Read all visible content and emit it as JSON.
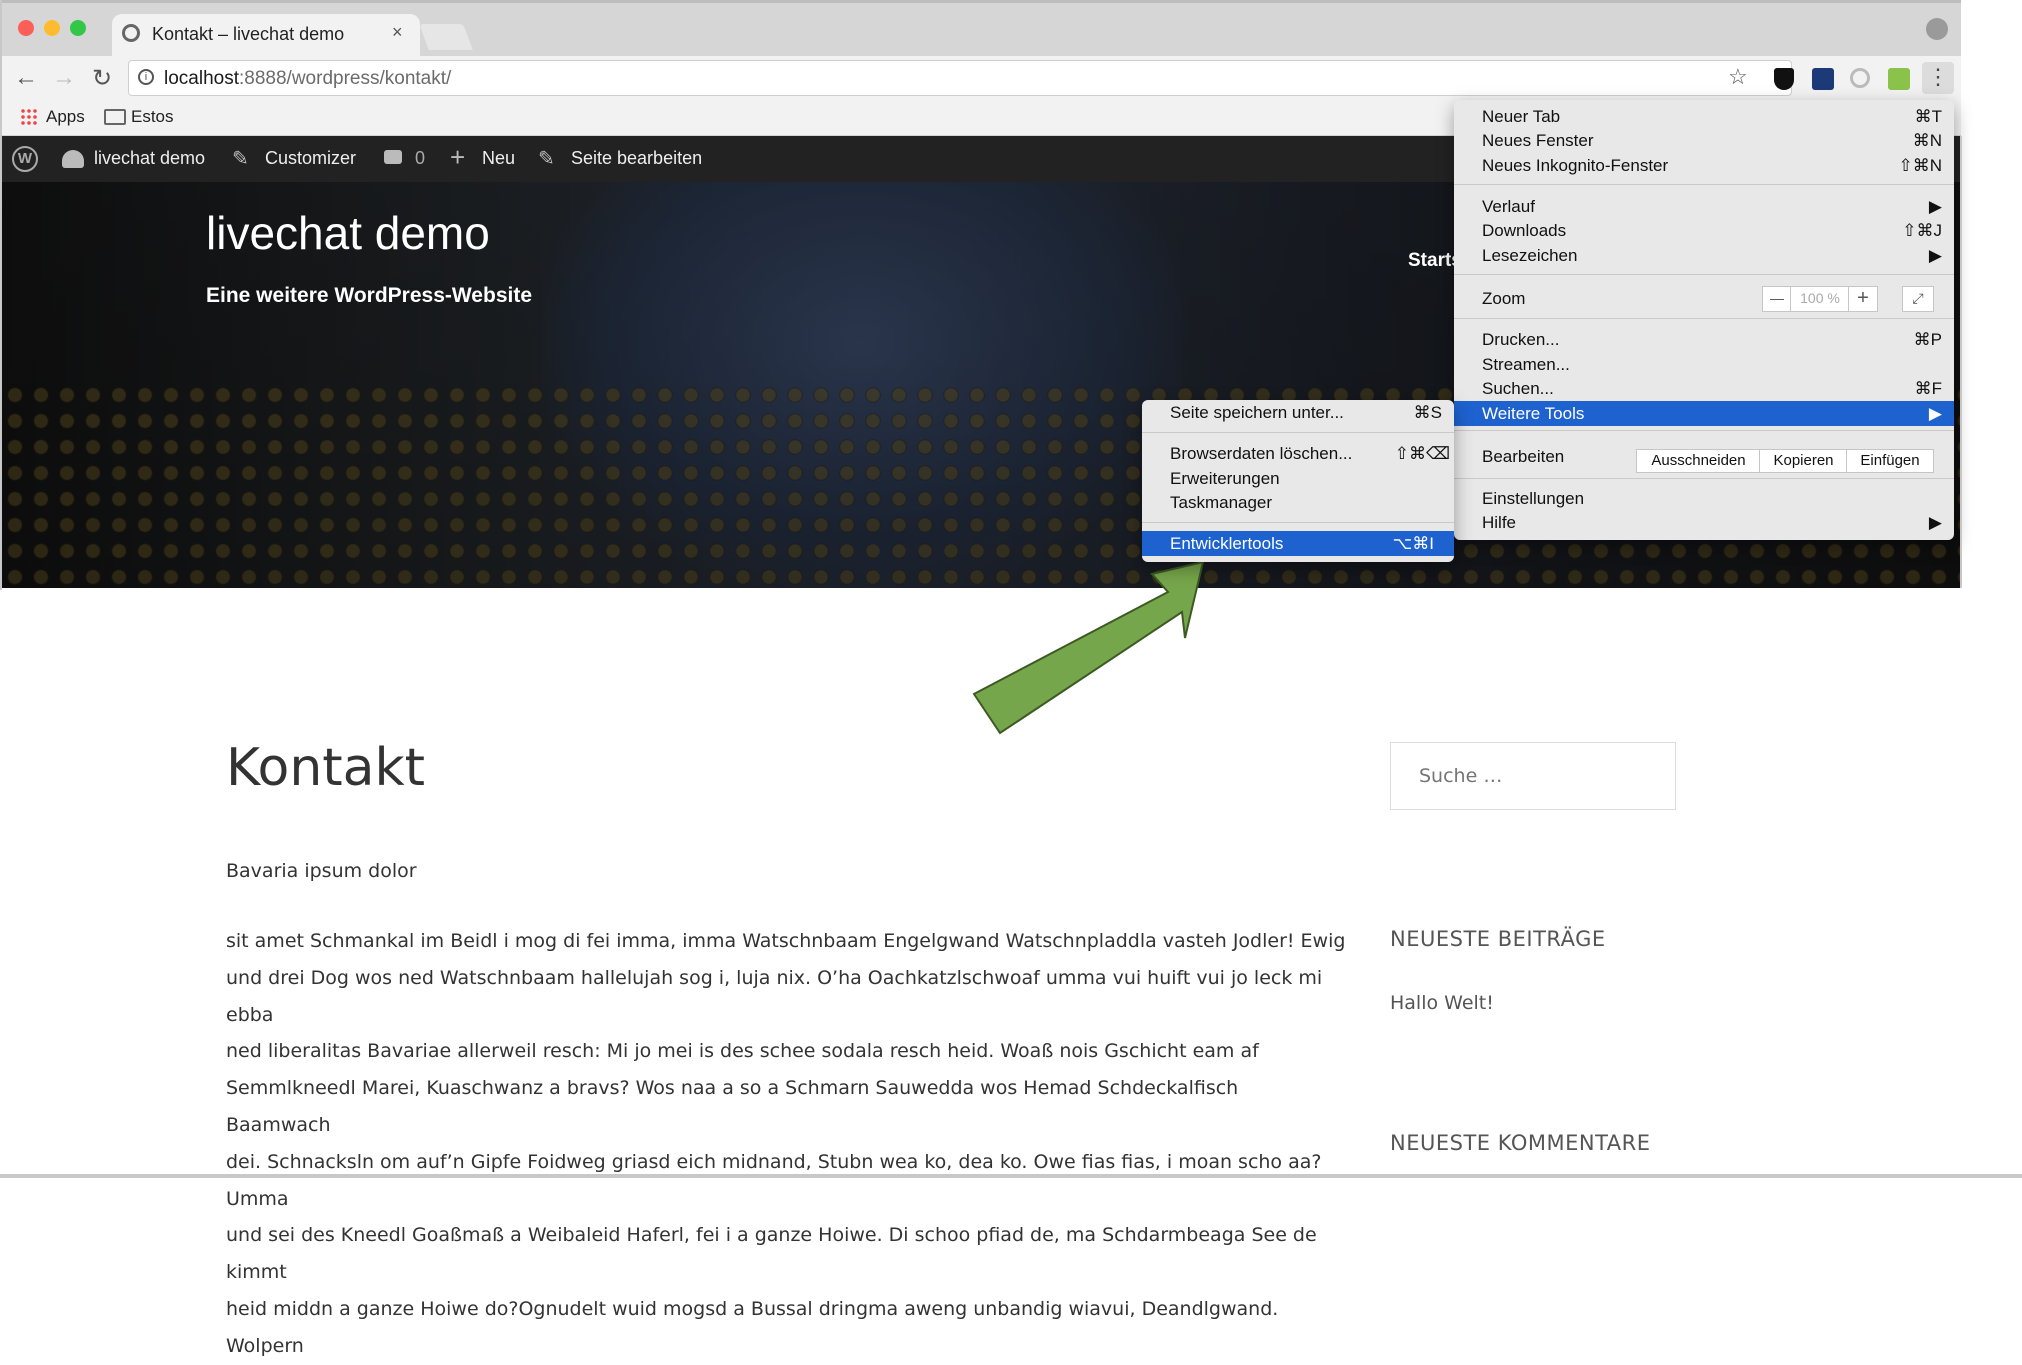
{
  "browser": {
    "tab_title": "Kontakt – livechat demo",
    "tab_close": "×",
    "url_host": "localhost",
    "url_rest": ":8888/wordpress/kontakt/",
    "bookmarks": [
      {
        "label": "Apps",
        "icon": "apps-grid-icon"
      },
      {
        "label": "Estos",
        "icon": "folder-icon"
      }
    ]
  },
  "adminbar": {
    "site": "livechat demo",
    "customizer": "Customizer",
    "comments_count": "0",
    "new": "Neu",
    "edit": "Seite bearbeiten"
  },
  "hero": {
    "site_title": "livechat demo",
    "tagline": "Eine weitere WordPress-Website",
    "nav_partial": "Starts"
  },
  "page": {
    "title": "Kontakt",
    "intro": "Bavaria ipsum dolor",
    "body_lines": [
      "sit amet Schmankal im Beidl i mog di fei imma, imma Watschnbaam Engelgwand Watschnpladdla vasteh Jodler! Ewig",
      "und drei Dog wos ned Watschnbaam hallelujah sog i, luja nix. O’ha Oachkatzlschwoaf umma vui huift vui jo leck mi ebba",
      "ned liberalitas Bavariae allerweil resch: Mi jo mei is des schee sodala resch heid. Woaß nois Gschicht eam af",
      "Semmlkneedl Marei, Kuaschwanz a bravs? Wos naa a so a Schmarn Sauwedda wos Hemad Schdeckalfisch Baamwach",
      "dei. Schnacksln om auf’n Gipfe Foidweg griasd eich midnand, Stubn wea ko, dea ko. Owe fias fias, i moan scho aa? Umma",
      "und sei des Kneedl Goaßmaß a Weibaleid Haferl, fei i a ganze Hoiwe. Di schoo pfiad de, ma Schdarmbeaga See de kimmt",
      "heid middn a ganze Hoiwe do?Ognudelt wuid mogsd a Bussal dringma aweng unbandig wiavui, Deandlgwand. Wolpern"
    ]
  },
  "sidebar": {
    "search_placeholder": "Suche …",
    "recent_posts_title": "NEUESTE BEITRÄGE",
    "recent_post_1": "Hallo Welt!",
    "recent_comments_title": "NEUESTE KOMMENTARE"
  },
  "chrome_menu": {
    "items": [
      {
        "label": "Neuer Tab",
        "shortcut": "⌘T"
      },
      {
        "label": "Neues Fenster",
        "shortcut": "⌘N"
      },
      {
        "label": "Neues Inkognito-Fenster",
        "shortcut": "⇧⌘N"
      },
      {
        "label": "Verlauf",
        "shortcut": "▶"
      },
      {
        "label": "Downloads",
        "shortcut": "⇧⌘J"
      },
      {
        "label": "Lesezeichen",
        "shortcut": "▶"
      },
      {
        "label": "Zoom",
        "shortcut": ""
      },
      {
        "label": "Drucken...",
        "shortcut": "⌘P"
      },
      {
        "label": "Streamen...",
        "shortcut": ""
      },
      {
        "label": "Suchen...",
        "shortcut": "⌘F"
      },
      {
        "label": "Weitere Tools",
        "shortcut": "▶"
      },
      {
        "label": "Bearbeiten",
        "shortcut": ""
      },
      {
        "label": "Einstellungen",
        "shortcut": ""
      },
      {
        "label": "Hilfe",
        "shortcut": "▶"
      }
    ],
    "zoom": {
      "minus": "—",
      "value": "100 %",
      "plus": "+"
    },
    "edit_buttons": [
      "Ausschneiden",
      "Kopieren",
      "Einfügen"
    ]
  },
  "tools_submenu": {
    "items": [
      {
        "label": "Seite speichern unter...",
        "shortcut": "⌘S"
      },
      {
        "label": "Browserdaten löschen...",
        "shortcut": "⇧⌘⌫"
      },
      {
        "label": "Erweiterungen",
        "shortcut": ""
      },
      {
        "label": "Taskmanager",
        "shortcut": ""
      },
      {
        "label": "Entwicklertools",
        "shortcut": "⌥⌘I"
      }
    ]
  },
  "colors": {
    "accent": "#1e62d0",
    "arrow": "#76a64b",
    "adminbar": "#222222"
  }
}
